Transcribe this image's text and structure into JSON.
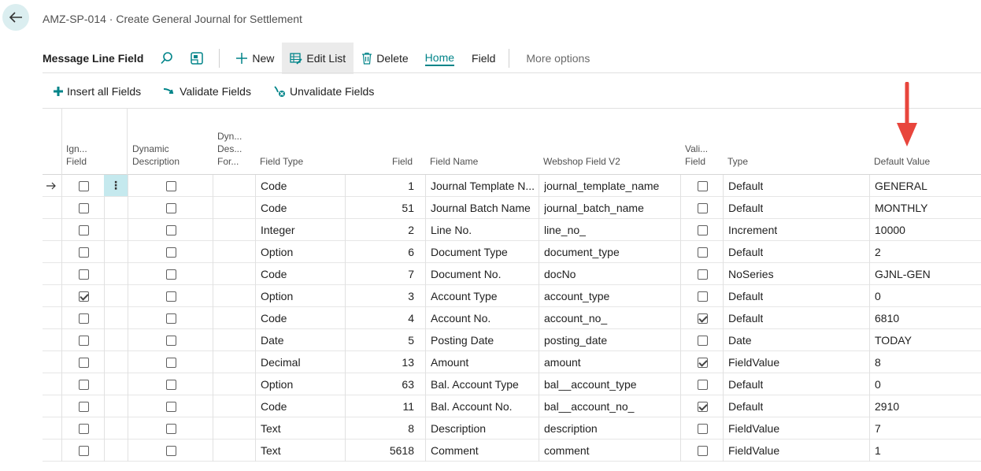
{
  "page": {
    "caption": "AMZ-SP-014 · Create General Journal for Settlement"
  },
  "actionbar": {
    "title": "Message Line Field",
    "new_label": "New",
    "edit_list_label": "Edit List",
    "delete_label": "Delete",
    "home_tab": "Home",
    "field_tab": "Field",
    "more_options": "More options"
  },
  "subbar": {
    "insert_all": "Insert all Fields",
    "validate": "Validate Fields",
    "unvalidate": "Unvalidate Fields"
  },
  "columns": {
    "ign": [
      "Ign...",
      "Field"
    ],
    "dynamic_desc": [
      "Dynamic",
      "Description"
    ],
    "dyn_desc_for": [
      "Dyn...",
      "Des...",
      "For..."
    ],
    "field_type": "Field Type",
    "field": "Field",
    "field_name": "Field Name",
    "webshop_field": "Webshop Field V2",
    "vali": [
      "Vali...",
      "Field"
    ],
    "type": "Type",
    "default_value": "Default Value"
  },
  "rows": [
    {
      "ign": false,
      "dyn": false,
      "field_type": "Code",
      "field": "1",
      "field_name": "Journal Template N...",
      "webshop": "journal_template_name",
      "vali": false,
      "type": "Default",
      "default": "GENERAL",
      "current": true
    },
    {
      "ign": false,
      "dyn": false,
      "field_type": "Code",
      "field": "51",
      "field_name": "Journal Batch Name",
      "webshop": "journal_batch_name",
      "vali": false,
      "type": "Default",
      "default": "MONTHLY"
    },
    {
      "ign": false,
      "dyn": false,
      "field_type": "Integer",
      "field": "2",
      "field_name": "Line No.",
      "webshop": "line_no_",
      "vali": false,
      "type": "Increment",
      "default": "10000"
    },
    {
      "ign": false,
      "dyn": false,
      "field_type": "Option",
      "field": "6",
      "field_name": "Document Type",
      "webshop": "document_type",
      "vali": false,
      "type": "Default",
      "default": "2"
    },
    {
      "ign": false,
      "dyn": false,
      "field_type": "Code",
      "field": "7",
      "field_name": "Document No.",
      "webshop": "docNo",
      "vali": false,
      "type": "NoSeries",
      "default": "GJNL-GEN"
    },
    {
      "ign": true,
      "dyn": false,
      "field_type": "Option",
      "field": "3",
      "field_name": "Account Type",
      "webshop": "account_type",
      "vali": false,
      "type": "Default",
      "default": "0"
    },
    {
      "ign": false,
      "dyn": false,
      "field_type": "Code",
      "field": "4",
      "field_name": "Account No.",
      "webshop": "account_no_",
      "vali": true,
      "type": "Default",
      "default": "6810"
    },
    {
      "ign": false,
      "dyn": false,
      "field_type": "Date",
      "field": "5",
      "field_name": "Posting Date",
      "webshop": "posting_date",
      "vali": false,
      "type": "Date",
      "default": "TODAY"
    },
    {
      "ign": false,
      "dyn": false,
      "field_type": "Decimal",
      "field": "13",
      "field_name": "Amount",
      "webshop": "amount",
      "vali": true,
      "type": "FieldValue",
      "default": "8"
    },
    {
      "ign": false,
      "dyn": false,
      "field_type": "Option",
      "field": "63",
      "field_name": "Bal. Account Type",
      "webshop": "bal__account_type",
      "vali": false,
      "type": "Default",
      "default": "0"
    },
    {
      "ign": false,
      "dyn": false,
      "field_type": "Code",
      "field": "11",
      "field_name": "Bal. Account No.",
      "webshop": "bal__account_no_",
      "vali": true,
      "type": "Default",
      "default": "2910"
    },
    {
      "ign": false,
      "dyn": false,
      "field_type": "Text",
      "field": "8",
      "field_name": "Description",
      "webshop": "description",
      "vali": false,
      "type": "FieldValue",
      "default": "7"
    },
    {
      "ign": false,
      "dyn": false,
      "field_type": "Text",
      "field": "5618",
      "field_name": "Comment",
      "webshop": "comment",
      "vali": false,
      "type": "FieldValue",
      "default": "1"
    }
  ],
  "colors": {
    "accent": "#008489",
    "selected_cell": "#c5e9ee",
    "annotation_arrow": "#e8453c"
  }
}
